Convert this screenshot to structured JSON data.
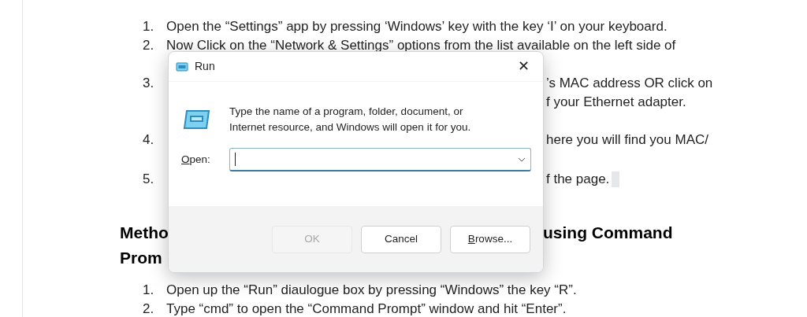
{
  "document": {
    "steps_top": [
      {
        "number": "1.",
        "text": "Open the “Settings” app by pressing ‘Windows’ key with the key ‘I’ on your keyboard.",
        "kind": "full"
      },
      {
        "number": "2.",
        "text": "Now Click on the “Network & Settings” options from the list available on the left side of",
        "kind": "full"
      },
      {
        "number": "3.",
        "text": "’s MAC address OR click on",
        "kind": "fragment"
      },
      {
        "text": "f your Ethernet adapter.",
        "kind": "fragment"
      },
      {
        "number": "4.",
        "text": "here you will find you MAC/",
        "kind": "fragment"
      },
      {
        "number": "5.",
        "text": "f the page.",
        "kind": "fragment",
        "highlight": true
      }
    ],
    "heading_lines": [
      {
        "left": "Metho",
        "right": "using Command"
      },
      {
        "left": "Prom"
      }
    ],
    "steps_bottom": [
      {
        "number": "1.",
        "text": "Open up the “Run” diaulogue box by pressing “Windows” the key “R”."
      },
      {
        "number": "2.",
        "text": "Type “cmd” to open the “Command Prompt” window and hit “Enter”."
      }
    ]
  },
  "dialog": {
    "title": "Run",
    "close": "✕",
    "description": "Type the name of a program, folder, document, or Internet resource, and Windows will open it for you.",
    "open_label": "Open:",
    "buttons": [
      {
        "label": "OK",
        "disabled": true
      },
      {
        "label": "Cancel",
        "disabled": false
      },
      {
        "label": "Browse...",
        "disabled": false
      }
    ]
  }
}
